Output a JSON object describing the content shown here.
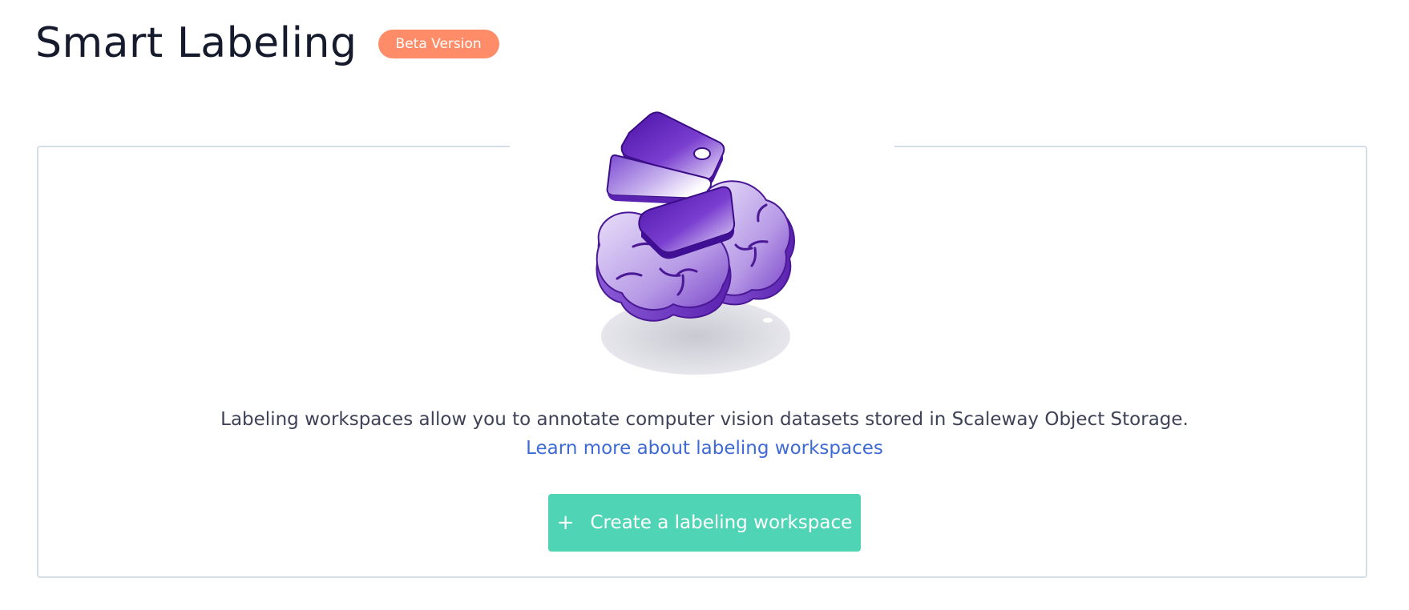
{
  "header": {
    "title": "Smart Labeling",
    "badge": "Beta Version"
  },
  "empty_state": {
    "illustration_icon": "brain-with-tags-illustration",
    "description": "Labeling workspaces allow you to annotate computer vision datasets stored in Scaleway Object Storage.",
    "learn_more_link": "Learn more about labeling workspaces",
    "create_button": {
      "icon": "plus-icon",
      "label": "Create a labeling workspace"
    }
  },
  "colors": {
    "title_text": "#151a2d",
    "badge_bg": "#ff8c69",
    "link": "#3e6ad6",
    "primary_button": "#4fd5b5",
    "card_border": "#d4dde6",
    "illustration_purple": "#5b1fb0"
  }
}
